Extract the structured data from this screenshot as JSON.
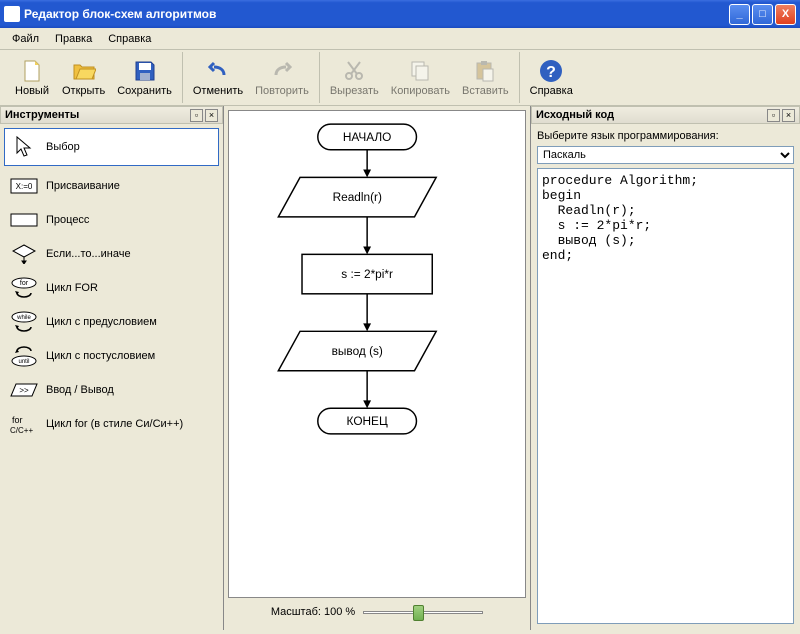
{
  "window": {
    "title": "Редактор блок-схем алгоритмов"
  },
  "menu": {
    "file": "Файл",
    "edit": "Правка",
    "help": "Справка"
  },
  "toolbar": {
    "new": "Новый",
    "open": "Открыть",
    "save": "Сохранить",
    "undo": "Отменить",
    "redo": "Повторить",
    "cut": "Вырезать",
    "copy": "Копировать",
    "paste": "Вставить",
    "help": "Справка"
  },
  "panels": {
    "tools": "Инструменты",
    "code": "Исходный код"
  },
  "tools": {
    "select": "Выбор",
    "assign": "Присваивание",
    "process": "Процесс",
    "if": "Если...то...иначе",
    "for": "Цикл FOR",
    "while": "Цикл с предусловием",
    "until": "Цикл с постусловием",
    "io": "Ввод / Вывод",
    "cfor": "Цикл for (в стиле Си/Си++)"
  },
  "flowchart": {
    "start": "НАЧАЛО",
    "input": "Readln(r)",
    "process": "s := 2*pi*r",
    "output": "вывод (s)",
    "end": "КОНЕЦ"
  },
  "zoom": {
    "label": "Масштаб: 100 %"
  },
  "code": {
    "lang_label": "Выберите язык программирования:",
    "lang_value": "Паскаль",
    "source": "procedure Algorithm;\nbegin\n  Readln(r);\n  s := 2*pi*r;\n  вывод (s);\nend;"
  }
}
